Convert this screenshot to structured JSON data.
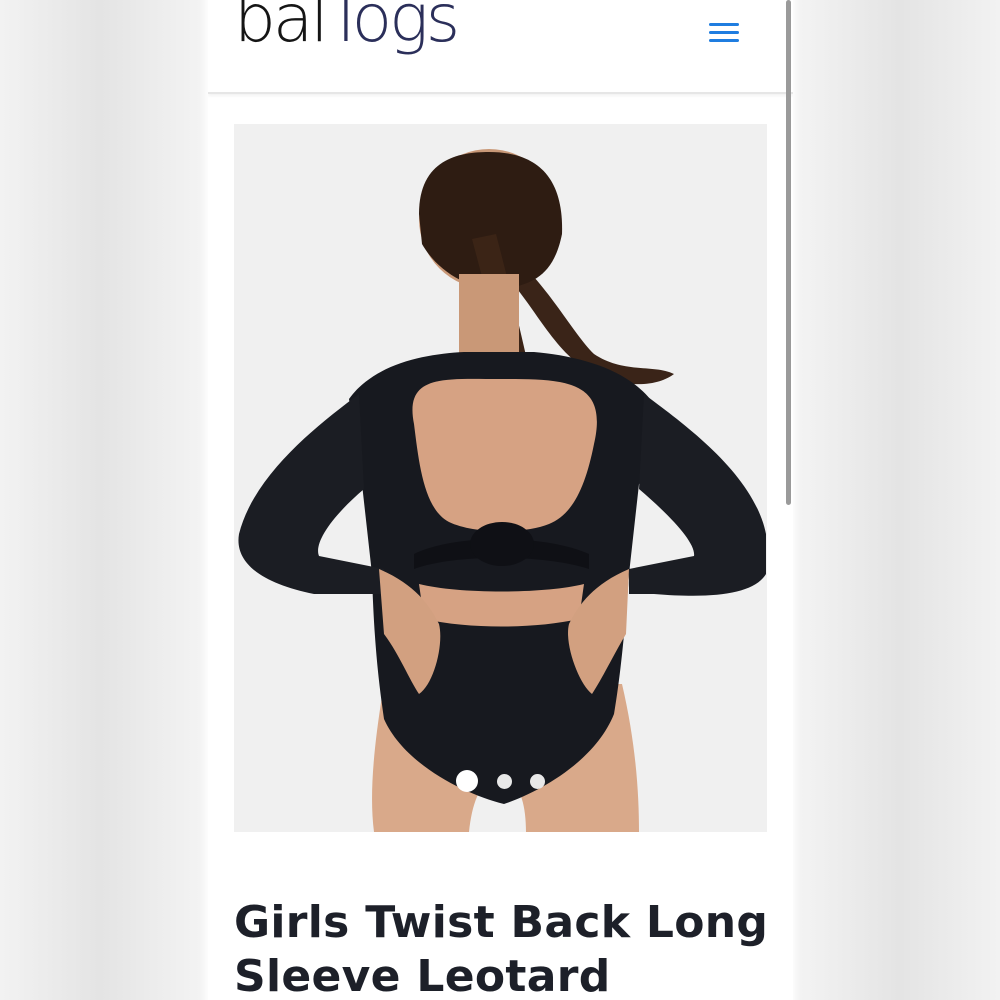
{
  "header": {
    "logo_part1": "bal",
    "logo_part2": "Togs",
    "menu_icon": "hamburger-menu-icon",
    "menu_color": "#1f7de0"
  },
  "product": {
    "image_icon": "product-photo",
    "gallery": {
      "slide_count": 3,
      "active_slide": 1
    },
    "title": "Girls Twist Back Long Sleeve Leotard"
  }
}
